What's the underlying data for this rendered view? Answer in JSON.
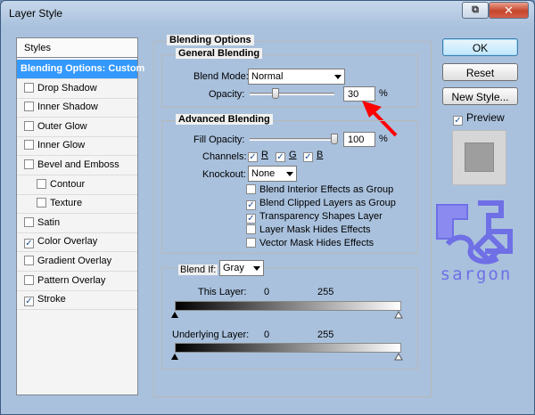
{
  "window": {
    "title": "Layer Style",
    "restore_glyph": "⧉",
    "close_glyph": "✕"
  },
  "styles_list": {
    "header": "Styles",
    "items": [
      {
        "label": "Blending Options: Custom",
        "selected": true,
        "checkbox": false,
        "checked": false,
        "sub": false
      },
      {
        "label": "Drop Shadow",
        "checkbox": true,
        "checked": false,
        "sub": false
      },
      {
        "label": "Inner Shadow",
        "checkbox": true,
        "checked": false,
        "sub": false
      },
      {
        "label": "Outer Glow",
        "checkbox": true,
        "checked": false,
        "sub": false
      },
      {
        "label": "Inner Glow",
        "checkbox": true,
        "checked": false,
        "sub": false
      },
      {
        "label": "Bevel and Emboss",
        "checkbox": true,
        "checked": false,
        "sub": false
      },
      {
        "label": "Contour",
        "checkbox": true,
        "checked": false,
        "sub": true
      },
      {
        "label": "Texture",
        "checkbox": true,
        "checked": false,
        "sub": true
      },
      {
        "label": "Satin",
        "checkbox": true,
        "checked": false,
        "sub": false
      },
      {
        "label": "Color Overlay",
        "checkbox": true,
        "checked": true,
        "sub": false
      },
      {
        "label": "Gradient Overlay",
        "checkbox": true,
        "checked": false,
        "sub": false
      },
      {
        "label": "Pattern Overlay",
        "checkbox": true,
        "checked": false,
        "sub": false
      },
      {
        "label": "Stroke",
        "checkbox": true,
        "checked": true,
        "sub": false
      }
    ]
  },
  "blending_options": {
    "title": "Blending Options",
    "general": {
      "title": "General Blending",
      "blend_mode_label": "Blend Mode:",
      "blend_mode_value": "Normal",
      "opacity_label": "Opacity:",
      "opacity_value": "30",
      "opacity_level": 30,
      "percent": "%"
    },
    "advanced": {
      "title": "Advanced Blending",
      "fill_opacity_label": "Fill Opacity:",
      "fill_opacity_value": "100",
      "fill_opacity_level": 100,
      "percent": "%",
      "channels_label": "Channels:",
      "channels": [
        {
          "label": "R",
          "checked": true
        },
        {
          "label": "G",
          "checked": true
        },
        {
          "label": "B",
          "checked": true
        }
      ],
      "knockout_label": "Knockout:",
      "knockout_value": "None",
      "options": [
        {
          "label": "Blend Interior Effects as Group",
          "checked": false
        },
        {
          "label": "Blend Clipped Layers as Group",
          "checked": true
        },
        {
          "label": "Transparency Shapes Layer",
          "checked": true
        },
        {
          "label": "Layer Mask Hides Effects",
          "checked": false
        },
        {
          "label": "Vector Mask Hides Effects",
          "checked": false
        }
      ]
    },
    "blend_if": {
      "label": "Blend If:",
      "value": "Gray",
      "this_layer_label": "This Layer:",
      "underlying_label": "Underlying Layer:",
      "low": "0",
      "high": "255"
    }
  },
  "buttons": {
    "ok": "OK",
    "reset": "Reset",
    "new_style": "New Style...",
    "preview_label": "Preview",
    "preview_checked": true
  },
  "watermark": {
    "text": "sargon"
  },
  "colors": {
    "selection": "#3399ff",
    "annotation_arrow": "#ff0000",
    "watermark": "#6f6fe6"
  }
}
